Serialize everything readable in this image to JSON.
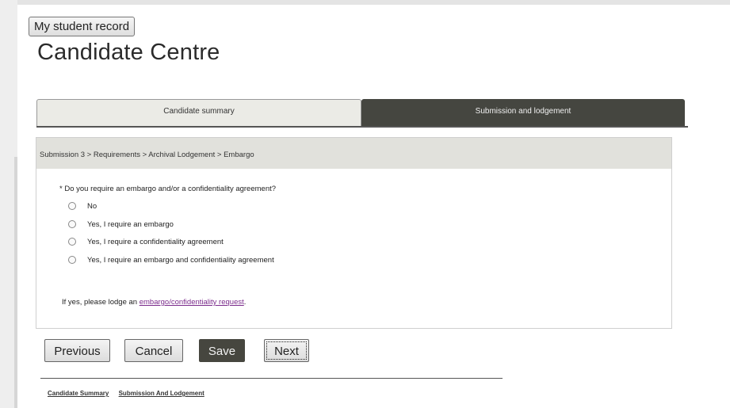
{
  "header": {
    "student_record_label": "My student record",
    "title": "Candidate Centre"
  },
  "tabs": [
    {
      "label": "Candidate summary",
      "active": false
    },
    {
      "label": "Submission and lodgement",
      "active": true
    }
  ],
  "breadcrumb": "Submission 3 > Requirements > Archival Lodgement > Embargo",
  "form": {
    "question": "* Do you require an embargo and/or a confidentiality agreement?",
    "options": [
      {
        "label": "No",
        "selected": false
      },
      {
        "label": "Yes, I require an embargo",
        "selected": false
      },
      {
        "label": "Yes, I require a confidentiality agreement",
        "selected": false
      },
      {
        "label": "Yes, I require an embargo and confidentiality agreement",
        "selected": false
      }
    ],
    "lodge_prefix": "If yes, please lodge an",
    "lodge_link": "embargo/confidentiality request",
    "lodge_suffix": "."
  },
  "actions": {
    "previous": "Previous",
    "cancel": "Cancel",
    "save": "Save",
    "next": "Next"
  },
  "footer": {
    "links": [
      "Candidate Summary",
      "Submission And Lodgement"
    ]
  },
  "colors": {
    "active_tab": "#454640",
    "link": "#7b2c8c",
    "breadcrumb_bg": "#e1e1dc"
  }
}
